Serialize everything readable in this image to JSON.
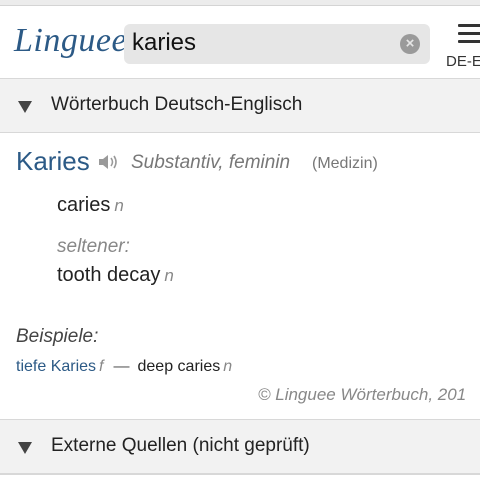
{
  "header": {
    "logo": "Linguee",
    "search_value": "karies",
    "clear_symbol": "×",
    "lang_label": "DE-E"
  },
  "sections": {
    "dictionary_title": "Wörterbuch Deutsch-Englisch",
    "external_title": "Externe Quellen (nicht geprüft)"
  },
  "entry": {
    "headword": "Karies",
    "pos": "Substantiv, feminin",
    "domain": "(Medizin)",
    "translations": [
      {
        "text": "caries",
        "gender": "n"
      },
      {
        "rarity": "seltener:",
        "text": "tooth decay",
        "gender": "n"
      }
    ]
  },
  "examples": {
    "label": "Beispiele:",
    "items": [
      {
        "source": "tiefe Karies",
        "source_gender": "f",
        "dash": "—",
        "target": "deep caries",
        "target_gender": "n"
      }
    ],
    "copyright": "© Linguee Wörterbuch, 201"
  },
  "colors": {
    "accent": "#2c5a86",
    "section_bg": "#f2f2f2"
  }
}
